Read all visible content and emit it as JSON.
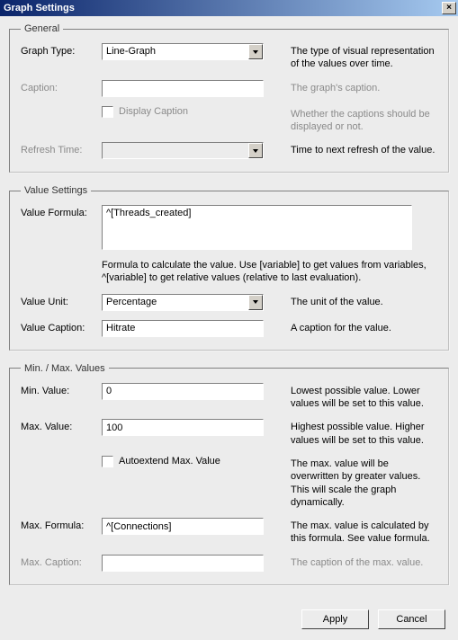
{
  "window": {
    "title": "Graph Settings"
  },
  "general": {
    "legend": "General",
    "graphType": {
      "label": "Graph Type:",
      "value": "Line-Graph",
      "desc": "The type of visual representation of the values over time."
    },
    "caption": {
      "label": "Caption:",
      "value": "",
      "desc": "The graph's caption."
    },
    "displayCaption": {
      "label": "Display Caption",
      "desc": "Whether the captions should be displayed or not."
    },
    "refreshTime": {
      "label": "Refresh Time:",
      "value": "",
      "desc": "Time to next refresh of the value."
    }
  },
  "valueSettings": {
    "legend": "Value Settings",
    "valueFormula": {
      "label": "Value Formula:",
      "value": "^[Threads_created]",
      "help": "Formula to calculate the value. Use [variable] to get values from variables, ^[variable] to get relative values (relative to last evaluation)."
    },
    "valueUnit": {
      "label": "Value Unit:",
      "value": "Percentage",
      "desc": "The unit of the value."
    },
    "valueCaption": {
      "label": "Value Caption:",
      "value": "Hitrate",
      "desc": "A caption for the value."
    }
  },
  "minmax": {
    "legend": "Min. / Max. Values",
    "minValue": {
      "label": "Min. Value:",
      "value": "0",
      "desc": "Lowest possible value. Lower values will be set to this value."
    },
    "maxValue": {
      "label": "Max. Value:",
      "value": "100",
      "desc": "Highest possible value. Higher values will be set to this value."
    },
    "autoextend": {
      "label": "Autoextend Max. Value",
      "desc": "The max. value will be overwritten by greater values. This will scale the graph dynamically."
    },
    "maxFormula": {
      "label": "Max. Formula:",
      "value": "^[Connections]",
      "desc": "The max. value is calculated by this formula. See value formula."
    },
    "maxCaption": {
      "label": "Max. Caption:",
      "value": "",
      "desc": "The caption of the max. value."
    }
  },
  "buttons": {
    "apply": "Apply",
    "cancel": "Cancel"
  }
}
